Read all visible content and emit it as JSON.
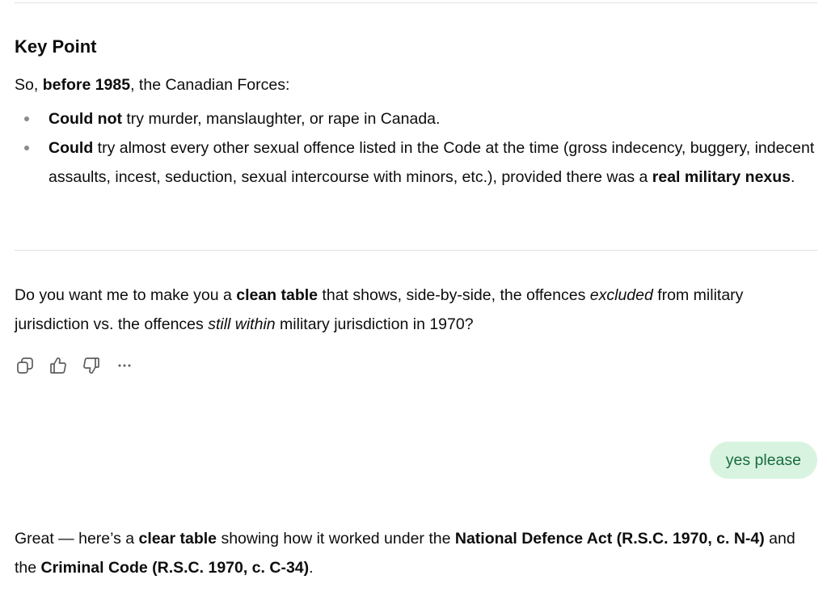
{
  "key_point": {
    "heading": "Key Point",
    "intro": {
      "prefix": "So, ",
      "bold": "before 1985",
      "suffix": ", the Canadian Forces:"
    },
    "bullets": [
      {
        "bold_lead": "Could not",
        "text": " try murder, manslaughter, or rape in Canada."
      },
      {
        "bold_lead": "Could",
        "text": " try almost every other sexual offence listed in the Code at the time (gross indecency, buggery, indecent assaults, incest, seduction, sexual intercourse with minors, etc.), provided there was a ",
        "bold_tail": "real military nexus",
        "end": "."
      }
    ]
  },
  "offer": {
    "part1": "Do you want me to make you a ",
    "bold1": "clean table",
    "part2": " that shows, side-by-side, the offences ",
    "italic1": "excluded",
    "part3": " from military jurisdiction vs. the offences ",
    "italic2": "still within",
    "part4": " military jurisdiction in 1970?"
  },
  "actions": {
    "icons": [
      "copy-icon",
      "thumbs-up-icon",
      "thumbs-down-icon",
      "more-icon"
    ]
  },
  "user_message": "yes please",
  "reply": {
    "part1": "Great — here’s a ",
    "bold1": "clear table",
    "part2": " showing how it worked under the ",
    "bold2": "National Defence Act (R.S.C. 1970, c. N-4)",
    "part3": " and the ",
    "bold3": "Criminal Code (R.S.C. 1970, c. C-34)",
    "part4": "."
  }
}
